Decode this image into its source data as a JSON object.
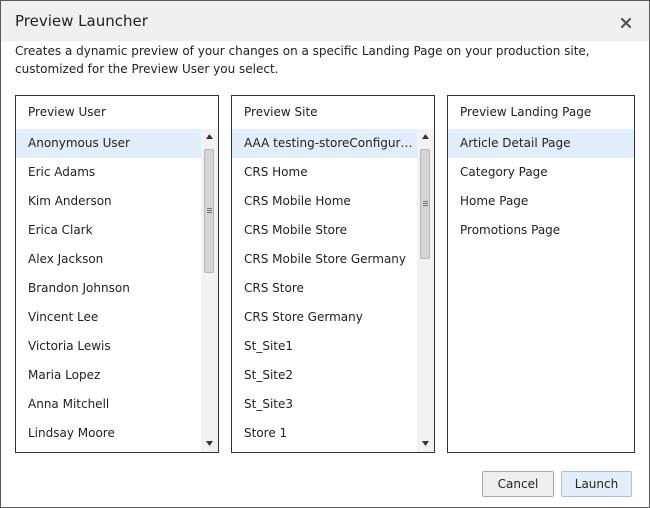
{
  "dialog": {
    "title": "Preview Launcher",
    "close_icon": "close-icon",
    "description": "Creates a dynamic preview of your changes on a specific Landing Page on your production site, customized for the Preview User you select."
  },
  "users": {
    "header": "Preview User",
    "selected": "Anonymous User",
    "items": [
      "Anonymous User",
      "Eric Adams",
      "Kim Anderson",
      "Erica Clark",
      "Alex Jackson",
      "Brandon Johnson",
      "Vincent Lee",
      "Victoria Lewis",
      "Maria Lopez",
      "Anna Mitchell",
      "Lindsay Moore"
    ]
  },
  "sites": {
    "header": "Preview Site",
    "selected": "AAA testing-storeConfigurat...",
    "items": [
      "AAA testing-storeConfigurat...",
      "CRS Home",
      "CRS Mobile Home",
      "CRS Mobile Store",
      "CRS Mobile Store Germany",
      "CRS Store",
      "CRS Store Germany",
      "St_Site1",
      "St_Site2",
      "St_Site3",
      "Store 1"
    ]
  },
  "pages": {
    "header": "Preview Landing Page",
    "selected": "Article Detail Page",
    "items": [
      "Article Detail Page",
      "Category Page",
      "Home Page",
      "Promotions Page"
    ]
  },
  "buttons": {
    "cancel": "Cancel",
    "launch": "Launch"
  },
  "colors": {
    "selected_row": "#e2eef9",
    "title_bar": "#f0f0f0",
    "launch_button": "#e4eef8"
  }
}
